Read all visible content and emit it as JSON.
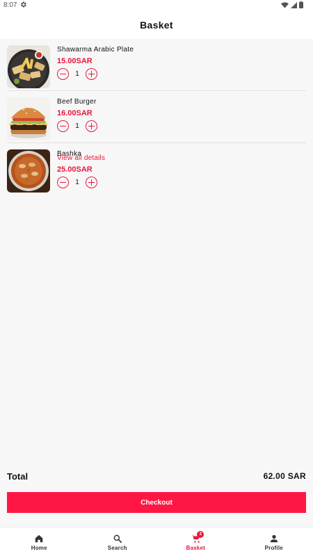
{
  "status_bar": {
    "time": "8:07"
  },
  "header": {
    "title": "Basket"
  },
  "items": [
    {
      "name": "Shawarma Arabic Plate",
      "price": "15.00SAR",
      "quantity": "1",
      "image": "shawarma-plate"
    },
    {
      "name": "Beef Burger",
      "price": "16.00SAR",
      "quantity": "1",
      "image": "beef-burger"
    },
    {
      "name": "Bashka",
      "link": "View all details",
      "price": "25.00SAR",
      "quantity": "1",
      "image": "bashka"
    }
  ],
  "summary": {
    "total_label": "Total",
    "total_value": "62.00 SAR"
  },
  "checkout_label": "Checkout",
  "bottom_nav": {
    "items": [
      {
        "label": "Home",
        "icon": "home-icon"
      },
      {
        "label": "Search",
        "icon": "search-icon"
      },
      {
        "label": "Basket",
        "icon": "cart-icon",
        "badge": "3",
        "active": true
      },
      {
        "label": "Profile",
        "icon": "person-icon"
      }
    ]
  },
  "colors": {
    "accent": "#e8173c",
    "checkout_button": "#ff1744",
    "background": "#f7f7f7"
  }
}
